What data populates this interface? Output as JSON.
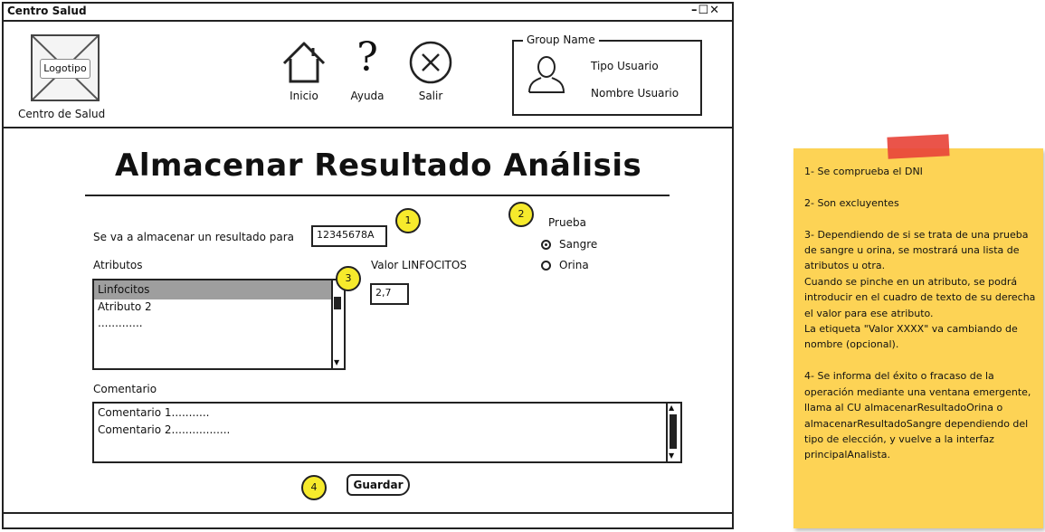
{
  "window": {
    "title": "Centro Salud",
    "controls": "–☐✕"
  },
  "header": {
    "logo_label": "Logotipo",
    "logo_caption": "Centro  de Salud",
    "nav": {
      "inicio": "Inicio",
      "ayuda": "Ayuda",
      "salir": "Salir"
    },
    "group": {
      "title": "Group Name",
      "user_type": "Tipo Usuario",
      "user_name": "Nombre Usuario"
    }
  },
  "main": {
    "title": "Almacenar Resultado Análisis",
    "dni_label": "Se va a almacenar un resultado para",
    "dni_value": "12345678A",
    "attributes_label": "Atributos",
    "attributes": [
      "Linfocitos",
      "Atributo 2",
      "............."
    ],
    "value_label": "Valor LINFOCITOS",
    "value": "2,7",
    "test_label": "Prueba",
    "test_options": [
      {
        "label": "Sangre",
        "selected": true
      },
      {
        "label": "Orina",
        "selected": false
      }
    ],
    "comment_label": "Comentario",
    "comments": [
      "Comentario 1...........",
      "Comentario 2................."
    ],
    "save_button": "Guardar",
    "badges": [
      "1",
      "2",
      "3",
      "4"
    ]
  },
  "note": {
    "text": "1- Se comprueba el DNI\n\n2- Son excluyentes\n\n3- Dependiendo de si se trata de una prueba de sangre u orina, se mostrará una lista de atributos u otra.\nCuando se pinche en un atributo, se podrá introducir en el cuadro de texto de su derecha el valor para ese atributo.\nLa etiqueta \"Valor XXXX\" va cambiando de nombre (opcional).\n\n4- Se informa del éxito o fracaso de la operación mediante una ventana emergente, llama al CU almacenarResultadoOrina o almacenarResultadoSangre dependiendo del tipo de elección, y vuelve a la interfaz principalAnalista."
  },
  "colors": {
    "highlight": "#f6ea2c",
    "note": "#fdd355",
    "tape": "#e8453b",
    "selection": "#9e9e9e"
  }
}
